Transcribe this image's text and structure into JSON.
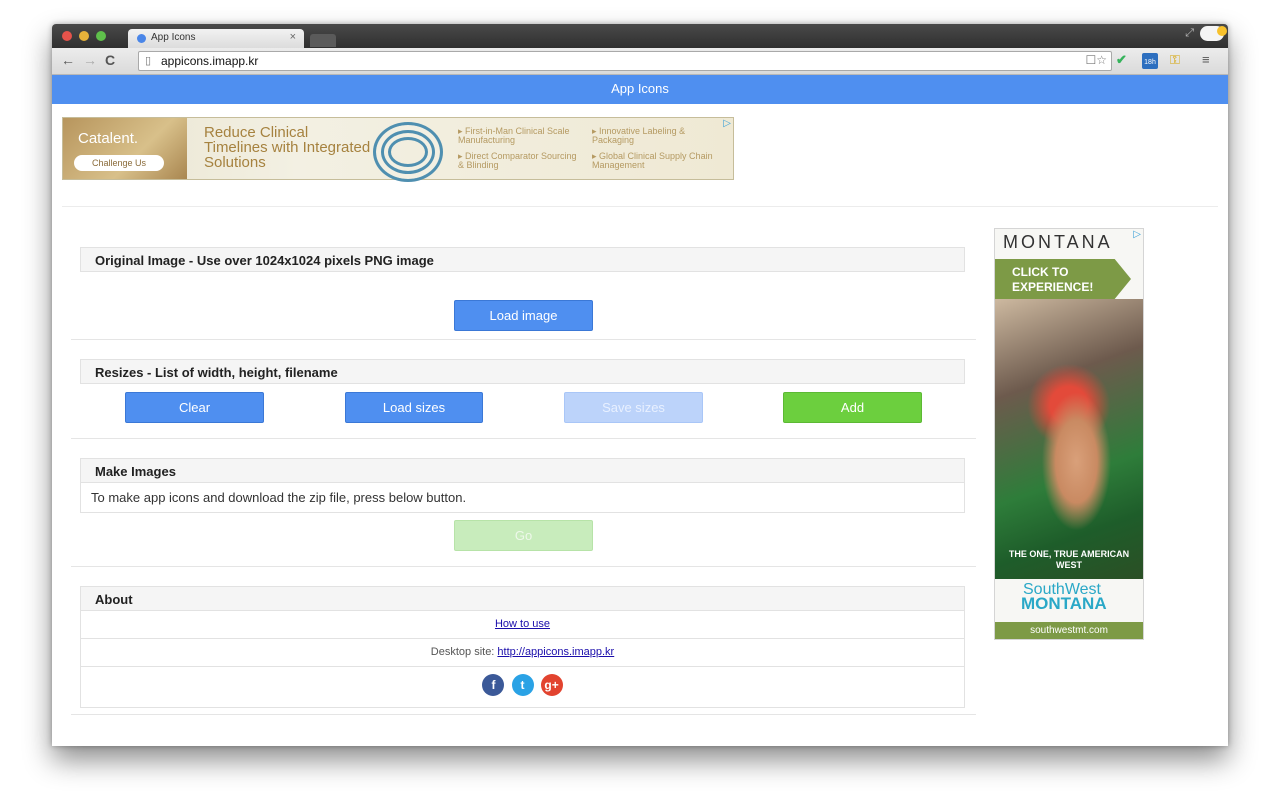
{
  "browser": {
    "tab_title": "App Icons",
    "tab_close": "×",
    "url": "appicons.imapp.kr",
    "calendar_badge": "18h"
  },
  "app": {
    "header_title": "App Icons"
  },
  "top_ad": {
    "logo": "Catalent.",
    "challenge": "Challenge Us",
    "headline": "Reduce Clinical Timelines with Integrated Solutions",
    "bullets": [
      "▸ First-in-Man Clinical Scale Manufacturing",
      "▸ Innovative Labeling & Packaging",
      "▸ Direct Comparator Sourcing & Blinding",
      "▸ Global Clinical Supply Chain Management"
    ]
  },
  "original_panel": {
    "heading": "Original Image - Use over 1024x1024 pixels PNG image",
    "load_button": "Load image"
  },
  "resizes_panel": {
    "heading": "Resizes - List of width, height, filename",
    "clear_button": "Clear",
    "load_sizes_button": "Load sizes",
    "save_sizes_button": "Save sizes",
    "add_button": "Add"
  },
  "make_panel": {
    "heading": "Make Images",
    "description": "To make app icons and download the zip file, press below button.",
    "go_button": "Go"
  },
  "about_panel": {
    "heading": "About",
    "how_to_use": "How to use",
    "desktop_label": "Desktop site: ",
    "desktop_link": "http://appicons.imapp.kr",
    "social": [
      "f",
      "t",
      "g+"
    ]
  },
  "side_ad": {
    "title": "MONTANA",
    "cta": "CLICK TO EXPERIENCE!",
    "tagline": "THE ONE, TRUE AMERICAN WEST",
    "brand_line1": "SouthWest",
    "brand_line2": "MONTANA",
    "footer": "southwestmt.com"
  },
  "colors": {
    "header_blue": "#4f8ff0",
    "button_blue": "#4f8ff0",
    "button_green": "#6ccf3e",
    "go_disabled": "#c8ecbc"
  }
}
